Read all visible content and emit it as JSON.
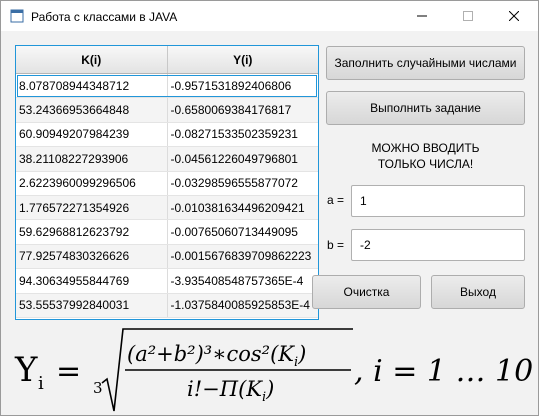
{
  "window": {
    "title": "Работа с классами в JAVA",
    "controls": [
      "minimize-icon",
      "maximize-icon",
      "close-icon"
    ]
  },
  "table": {
    "columns": [
      "K(i)",
      "Y(i)"
    ],
    "rows": [
      [
        "8.078708944348712",
        "-0.9571531892406806"
      ],
      [
        "53.24366953664848",
        "-0.6580069384176817"
      ],
      [
        "60.90949207984239",
        "-0.0827153350235923 1"
      ],
      [
        "38.21108227293906",
        "-0.04561226049796801"
      ],
      [
        "2.6223960099296506",
        "-0.03298596555877072"
      ],
      [
        "1.776572271354926",
        "-0.010381634496209421"
      ],
      [
        "59.62968812623792",
        "-0.00765060713449095"
      ],
      [
        "77.92574830326626",
        "-0.0015676839709862223"
      ],
      [
        "94.30634955844769",
        "-3.935408548757365E-4"
      ],
      [
        "53.55537992840031",
        "-1.0375840085925853E-4"
      ]
    ],
    "selected_row": 0
  },
  "buttons": {
    "fill_random": "Заполнить случайными числами",
    "run_task": "Выполнить задание",
    "clear": "Очистка",
    "exit": "Выход"
  },
  "notice": {
    "line1": "МОЖНО ВВОДИТЬ",
    "line2": "ТОЛЬКО ЧИСЛА!"
  },
  "inputs": {
    "a_label": "a =",
    "a_value": "1",
    "b_label": "b =",
    "b_value": "-2"
  },
  "formula": {
    "lhs": "Y",
    "lhs_sub": "i",
    "eq": "=",
    "root_index": "3",
    "numerator": "(a²+b²)³∗cos²(K",
    "numerator_sub": "i",
    "numerator_close": ")",
    "denominator": "i!−Π(K",
    "denominator_sub": "i",
    "denominator_close": ")",
    "range": ", i = 1 … 10"
  },
  "colors": {
    "accent": "#2196d9",
    "window_bg": "#f2f2f2"
  }
}
